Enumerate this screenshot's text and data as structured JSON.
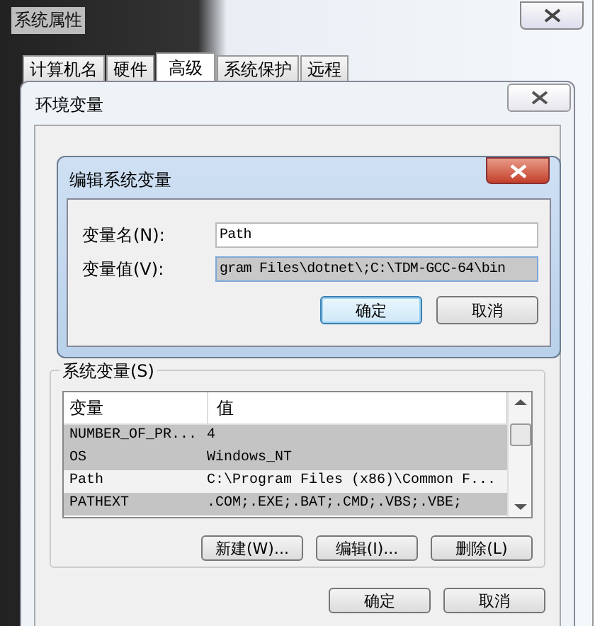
{
  "window": {
    "title": "系统属性"
  },
  "tabs": [
    {
      "label": "计算机名",
      "selected": false
    },
    {
      "label": "硬件",
      "selected": false
    },
    {
      "label": "高级",
      "selected": true
    },
    {
      "label": "系统保护",
      "selected": false
    },
    {
      "label": "远程",
      "selected": false
    }
  ],
  "env_dialog": {
    "title": "环境变量",
    "system_group": "系统变量(S)",
    "columns": [
      "变量",
      "值"
    ],
    "rows": [
      {
        "name": "NUMBER_OF_PR...",
        "value": "4",
        "selected": false
      },
      {
        "name": "OS",
        "value": "Windows_NT",
        "selected": false
      },
      {
        "name": "Path",
        "value": "C:\\Program Files (x86)\\Common F...",
        "selected": true
      },
      {
        "name": "PATHEXT",
        "value": ".COM;.EXE;.BAT;.CMD;.VBS;.VBE;",
        "selected": false
      }
    ],
    "buttons": [
      "新建(W)...",
      "编辑(I)...",
      "删除(L)"
    ],
    "footer_buttons": [
      "确定",
      "取消"
    ]
  },
  "edit_dialog": {
    "title": "编辑系统变量",
    "fields": [
      {
        "label": "变量名(N):",
        "value": "Path",
        "focused": false
      },
      {
        "label": "变量值(V):",
        "value": "gram Files\\dotnet\\;C:\\TDM-GCC-64\\bin",
        "focused": true
      }
    ],
    "buttons": [
      {
        "label": "确定",
        "default": true
      },
      {
        "label": "取消",
        "default": false
      }
    ]
  }
}
